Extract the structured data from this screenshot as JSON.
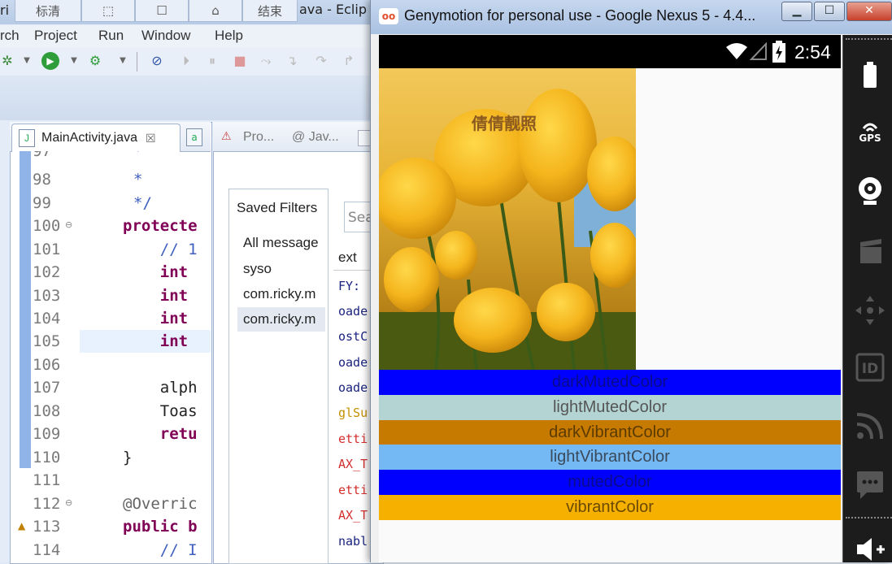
{
  "eclipse": {
    "title_tabs": [
      "标清",
      "",
      "",
      "",
      "结束"
    ],
    "title_text": "ava - Eclip",
    "left_fragment": "ri",
    "menu": [
      "rch",
      "Project",
      "Run",
      "Window",
      "Help"
    ],
    "editor_tab": "MainActivity.java",
    "code": [
      {
        "ln": "97",
        "code": "*"
      },
      {
        "ln": "98",
        "code": "*"
      },
      {
        "ln": "99",
        "code": "*/"
      },
      {
        "ln": "100",
        "code": "protecte"
      },
      {
        "ln": "101",
        "code": "    // 1"
      },
      {
        "ln": "102",
        "code": "    int"
      },
      {
        "ln": "103",
        "code": "    int"
      },
      {
        "ln": "104",
        "code": "    int"
      },
      {
        "ln": "105",
        "code": "    int"
      },
      {
        "ln": "106",
        "code": ""
      },
      {
        "ln": "107",
        "code": "    alph"
      },
      {
        "ln": "108",
        "code": "    Toas"
      },
      {
        "ln": "109",
        "code": "    retu"
      },
      {
        "ln": "110",
        "code": "}"
      },
      {
        "ln": "111",
        "code": ""
      },
      {
        "ln": "112",
        "code": "@Overric"
      },
      {
        "ln": "113",
        "code": "public b"
      },
      {
        "ln": "114",
        "code": "    // I"
      }
    ],
    "logcat_tabs": [
      "Pro...",
      "@ Jav..."
    ],
    "saved_filters_title": "Saved Filters",
    "filters": [
      "All message",
      "syso",
      "com.ricky.m",
      "com.ricky.m"
    ],
    "search_placeholder": "Sea",
    "log_col_header": "ext",
    "log_lines": [
      {
        "text": "FY:",
        "color": "#1a237e"
      },
      {
        "text": "oade",
        "color": "#1a237e"
      },
      {
        "text": "ostC",
        "color": "#1a237e"
      },
      {
        "text": "oade",
        "color": "#1a237e"
      },
      {
        "text": "oade",
        "color": "#1a237e"
      },
      {
        "text": "glSu",
        "color": "#c49000"
      },
      {
        "text": "etti",
        "color": "#d32f2f"
      },
      {
        "text": "AX_T",
        "color": "#d32f2f"
      },
      {
        "text": "etti",
        "color": "#d32f2f"
      },
      {
        "text": "AX_T",
        "color": "#d32f2f"
      },
      {
        "text": "nabl",
        "color": "#1a237e"
      }
    ]
  },
  "genymotion": {
    "title": "Genymotion for personal use - Google Nexus 5 - 4.4...",
    "logo": "oo",
    "time": "2:54",
    "photo_caption": "倩倩靓照",
    "swatches": [
      {
        "label": "darkMutedColor",
        "bg": "#0000ff",
        "fg": "#0a0a8a"
      },
      {
        "label": "lightMutedColor",
        "bg": "#b4d4d4",
        "fg": "#555555"
      },
      {
        "label": "darkVibrantColor",
        "bg": "#c67a00",
        "fg": "#5a3a00"
      },
      {
        "label": "lightVibrantColor",
        "bg": "#74b8f4",
        "fg": "#3a4a5a"
      },
      {
        "label": "mutedColor",
        "bg": "#0000ff",
        "fg": "#0a0a8a"
      },
      {
        "label": "vibrantColor",
        "bg": "#f6b000",
        "fg": "#6a4a00"
      }
    ],
    "sidebar": {
      "gps_label": "GPS",
      "id_label": "ID"
    }
  }
}
